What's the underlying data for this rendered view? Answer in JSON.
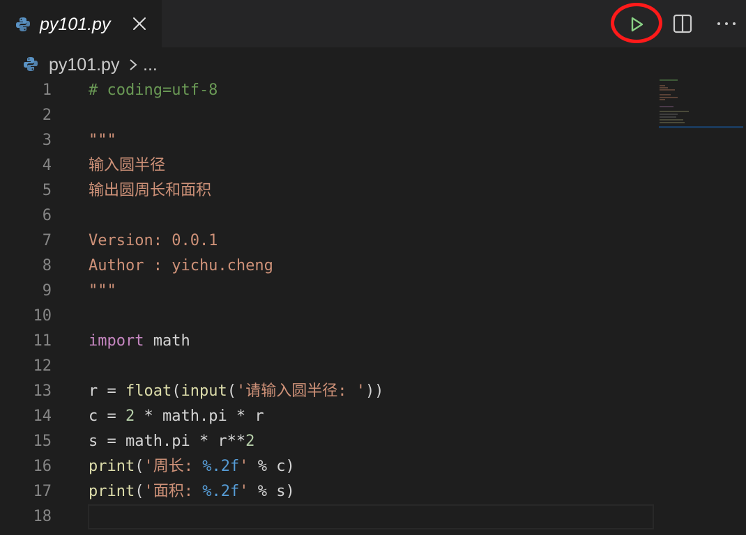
{
  "tab": {
    "label": "py101.py"
  },
  "breadcrumb": {
    "file": "py101.py",
    "more": "..."
  },
  "colors": {
    "run_icon": "#89d185",
    "highlight": "#ff1a1a",
    "comment": "#6a9955",
    "string": "#ce9178",
    "keyword": "#c586c0",
    "function": "#dcdcaa",
    "number": "#b5cea8",
    "format": "#569cd6"
  },
  "icons": {
    "file": "python-icon",
    "close": "close-icon",
    "run": "play-icon",
    "split": "split-editor-icon",
    "more": "more-actions-icon",
    "chevron": "chevron-right-icon"
  },
  "code": {
    "l1": {
      "n": "1",
      "t1": "# coding=utf-8"
    },
    "l2": {
      "n": "2"
    },
    "l3": {
      "n": "3",
      "t1": "\"\"\""
    },
    "l4": {
      "n": "4",
      "t1": "输入圆半径"
    },
    "l5": {
      "n": "5",
      "t1": "输出圆周长和面积"
    },
    "l6": {
      "n": "6"
    },
    "l7": {
      "n": "7",
      "t1": "Version: 0.0.1"
    },
    "l8": {
      "n": "8",
      "t1": "Author : yichu.cheng"
    },
    "l9": {
      "n": "9",
      "t1": "\"\"\""
    },
    "l10": {
      "n": "10"
    },
    "l11": {
      "n": "11",
      "t1": "import",
      "t2": " math"
    },
    "l12": {
      "n": "12"
    },
    "l13": {
      "n": "13",
      "t1": "r = ",
      "t2": "float",
      "t3": "(",
      "t4": "input",
      "t5": "(",
      "t6": "'请输入圆半径: '",
      "t7": "))"
    },
    "l14": {
      "n": "14",
      "t1": "c = ",
      "t2": "2",
      "t3": " * math.pi * r"
    },
    "l15": {
      "n": "15",
      "t1": "s = math.pi * r**",
      "t2": "2"
    },
    "l16": {
      "n": "16",
      "t1": "print",
      "t2": "(",
      "t3": "'周长: ",
      "t4": "%.2f",
      "t5": "'",
      "t6": " % c)"
    },
    "l17": {
      "n": "17",
      "t1": "print",
      "t2": "(",
      "t3": "'面积: ",
      "t4": "%.2f",
      "t5": "'",
      "t6": " % s)"
    },
    "l18": {
      "n": "18"
    }
  }
}
